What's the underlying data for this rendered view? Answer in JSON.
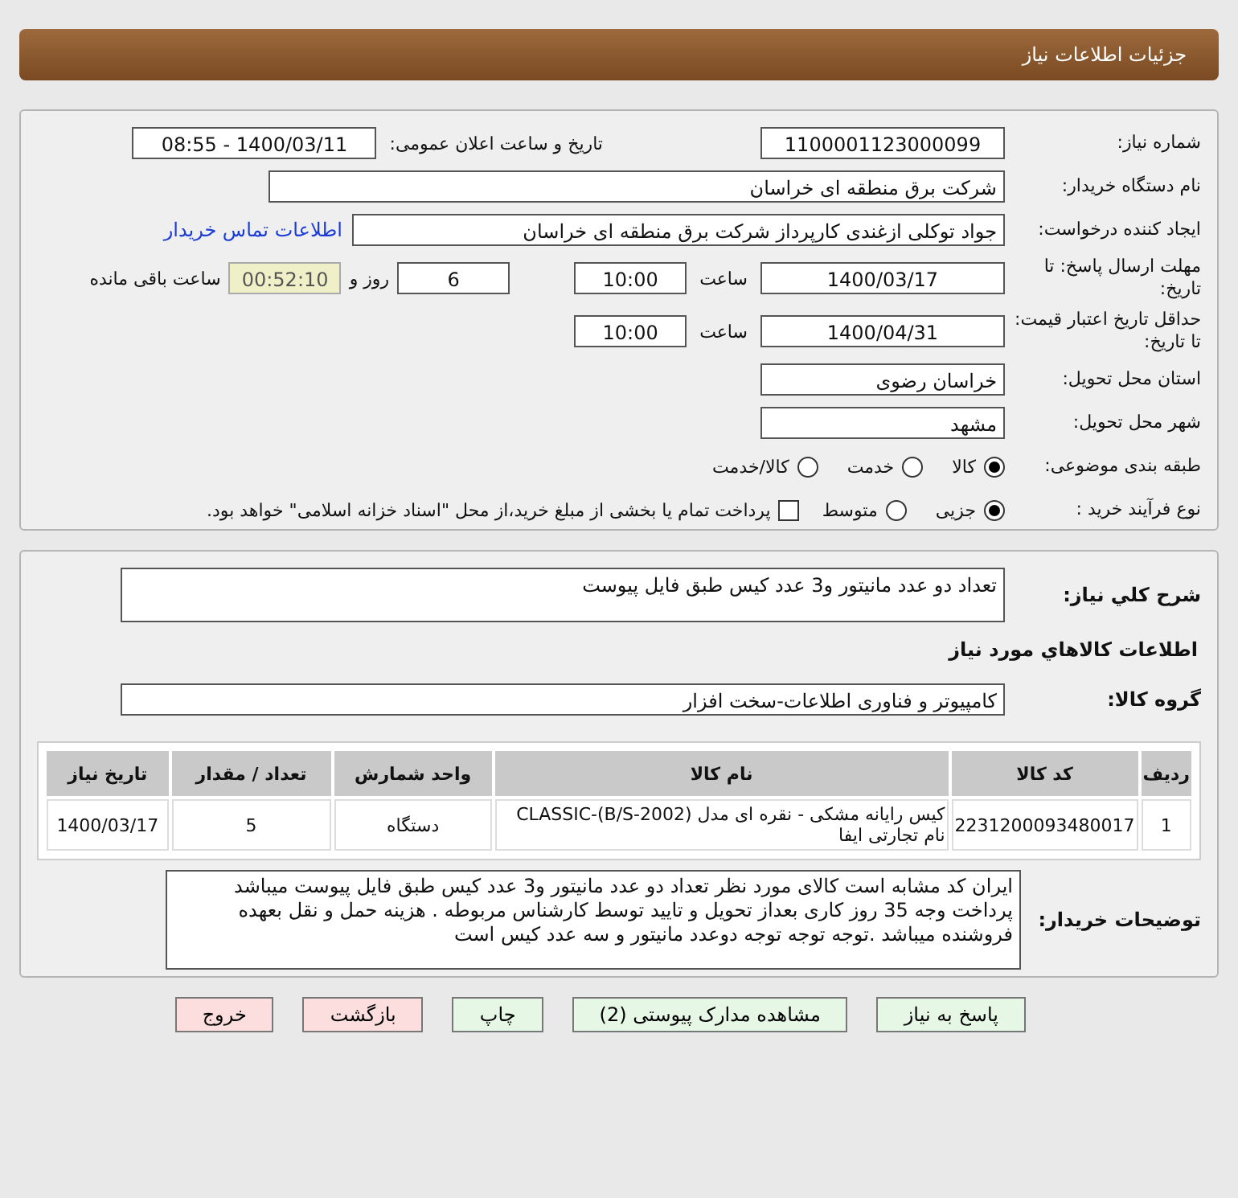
{
  "window": {
    "title": "جزئیات اطلاعات نیاز"
  },
  "need_number": {
    "label": "شماره نیاز:",
    "value": "1100001123000099"
  },
  "announce": {
    "label": "تاریخ و ساعت اعلان عمومی:",
    "value": "1400/03/11 - 08:55"
  },
  "buyer": {
    "label": "نام دستگاه خریدار:",
    "value": "شرکت برق منطقه ای خراسان"
  },
  "creator": {
    "label": "ایجاد کننده درخواست:",
    "value": "جواد توکلی ازغندی کارپرداز شرکت برق منطقه ای خراسان",
    "link": "اطلاعات تماس خریدار"
  },
  "deadline": {
    "label": "مهلت ارسال پاسخ: تا تاریخ:",
    "date": "1400/03/17",
    "time_label": "ساعت",
    "time": "10:00",
    "days": "6",
    "days_label": "روز و",
    "remaining": "00:52:10",
    "remaining_label": "ساعت باقی مانده"
  },
  "validity": {
    "label": "حداقل تاریخ اعتبار قیمت: تا تاریخ:",
    "date": "1400/04/31",
    "time_label": "ساعت",
    "time": "10:00"
  },
  "province": {
    "label": "استان محل تحویل:",
    "value": "خراسان رضوی"
  },
  "city": {
    "label": "شهر محل تحویل:",
    "value": "مشهد"
  },
  "category": {
    "label": "طبقه بندی موضوعی:",
    "options": [
      {
        "label": "کالا",
        "selected": true
      },
      {
        "label": "خدمت",
        "selected": false
      },
      {
        "label": "کالا/خدمت",
        "selected": false
      }
    ]
  },
  "process": {
    "label": "نوع فرآیند خرید :",
    "options": [
      {
        "label": "جزیی",
        "selected": true
      },
      {
        "label": "متوسط",
        "selected": false
      }
    ],
    "payment": {
      "label": "پرداخت تمام یا بخشی از مبلغ خرید،از محل \"اسناد خزانه اسلامی\" خواهد بود.",
      "checked": false
    }
  },
  "description": {
    "label": "شرح کلي نياز:",
    "value": "تعداد دو عدد مانیتور و3 عدد کیس طبق فایل پیوست"
  },
  "goods_heading": "اطلاعات کالاهاي مورد نياز",
  "goods_group": {
    "label": "گروه کالا:",
    "value": "کامپیوتر و فناوری اطلاعات-سخت افزار"
  },
  "table": {
    "columns": [
      "ردیف",
      "کد کالا",
      "نام کالا",
      "واحد شمارش",
      "تعداد / مقدار",
      "تاریخ نیاز"
    ],
    "rows": [
      [
        "1",
        "2231200093480017",
        "کیس رایانه مشکی - نقره ای مدل CLASSIC-(B/S-2002) نام تجارتی ایفا",
        "دستگاه",
        "5",
        "1400/03/17"
      ]
    ]
  },
  "buyer_notes": {
    "label": "توضیحات خریدار:",
    "text": "ایران کد مشابه است کالای مورد نظر تعداد دو عدد مانیتور و3 عدد کیس طبق فایل پیوست میباشد پرداخت وجه 35 روز کاری بعداز تحویل و تایید توسط کارشناس مربوطه . هزینه حمل و نقل بعهده فروشنده میباشد .توجه توجه توجه دوعدد مانیتور و سه عدد کیس است"
  },
  "buttons": [
    {
      "label": "پاسخ به نیاز",
      "kind": "normal"
    },
    {
      "label": "مشاهده مدارک پیوستی (2)",
      "kind": "normal"
    },
    {
      "label": "چاپ",
      "kind": "normal"
    },
    {
      "label": "بازگشت",
      "kind": "danger"
    },
    {
      "label": "خروج",
      "kind": "danger"
    }
  ]
}
